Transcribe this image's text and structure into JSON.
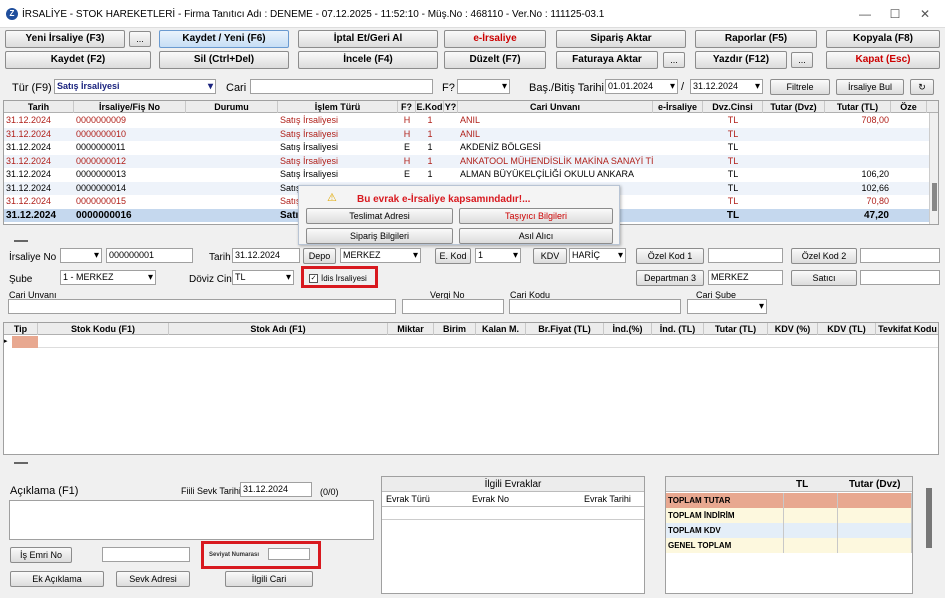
{
  "title": "İRSALİYE - STOK HAREKETLERİ - Firma Tanıtıcı Adı : DENEME - 07.12.2025 - 11:52:10 - Müş.No : 468110 - Ver.No : 111125-03.1",
  "toolbar1": {
    "yeni": "Yeni İrsaliye (F3)",
    "dots": "...",
    "kaydet_yeni": "Kaydet / Yeni (F6)",
    "iptal": "İptal Et/Geri Al",
    "eirsaliye": "e-İrsaliye",
    "siparis_aktar": "Sipariş Aktar",
    "raporlar": "Raporlar (F5)",
    "kopyala": "Kopyala (F8)"
  },
  "toolbar2": {
    "kaydet": "Kaydet (F2)",
    "sil": "Sil (Ctrl+Del)",
    "incele": "İncele (F4)",
    "duzelt": "Düzelt (F7)",
    "faturaya": "Faturaya Aktar",
    "dots1": "...",
    "yazdir": "Yazdır (F12)",
    "dots2": "...",
    "kapat": "Kapat (Esc)"
  },
  "filter": {
    "tur_label": "Tür (F9)",
    "tur_value": "Satış İrsaliyesi",
    "cari_label": "Cari",
    "f_label": "F?",
    "tarih_label": "Baş./Bitiş Tarihi",
    "start": "01.01.2024",
    "sep": "/",
    "end": "31.12.2024",
    "filtrele": "Filtrele",
    "irsaliye_bul": "İrsaliye Bul",
    "refresh": "↻"
  },
  "list_headers": [
    "Tarih",
    "İrsaliye/Fiş No",
    "Durumu",
    "İşlem Türü",
    "F?",
    "E.Kod",
    "Y?",
    "Cari Unvanı",
    "e-İrsaliye",
    "Dvz.Cinsi",
    "Tutar (Dvz)",
    "Tutar (TL)",
    "Öze"
  ],
  "list_rows": [
    {
      "tarih": "31.12.2024",
      "no": "0000000009",
      "islem": "Satış İrsaliyesi",
      "f": "H",
      "ekod": "1",
      "cari": "ANIL",
      "dvz": "TL",
      "tl": "708,00",
      "red": true
    },
    {
      "tarih": "31.12.2024",
      "no": "0000000010",
      "islem": "Satış İrsaliyesi",
      "f": "H",
      "ekod": "1",
      "cari": "ANIL",
      "dvz": "TL",
      "tl": "",
      "red": true
    },
    {
      "tarih": "31.12.2024",
      "no": "0000000011",
      "islem": "Satış İrsaliyesi",
      "f": "E",
      "ekod": "1",
      "cari": "AKDENİZ BÖLGESİ",
      "dvz": "TL",
      "tl": "",
      "red": false
    },
    {
      "tarih": "31.12.2024",
      "no": "0000000012",
      "islem": "Satış İrsaliyesi",
      "f": "H",
      "ekod": "1",
      "cari": "ANKATOOL MÜHENDİSLİK MAKİNA SANAYİ TİCAR",
      "dvz": "TL",
      "tl": "",
      "red": true
    },
    {
      "tarih": "31.12.2024",
      "no": "0000000013",
      "islem": "Satış İrsaliyesi",
      "f": "E",
      "ekod": "1",
      "cari": "ALMAN BÜYÜKELÇİLİĞİ OKULU ANKARA",
      "dvz": "TL",
      "tl": "106,20",
      "red": false
    },
    {
      "tarih": "31.12.2024",
      "no": "0000000014",
      "islem": "Satış",
      "f": "",
      "ekod": "",
      "cari": "",
      "dvz": "TL",
      "tl": "102,66",
      "red": false
    },
    {
      "tarih": "31.12.2024",
      "no": "0000000015",
      "islem": "Satış",
      "f": "",
      "ekod": "",
      "cari": "",
      "dvz": "TL",
      "tl": "70,80",
      "red": true
    },
    {
      "tarih": "31.12.2024",
      "no": "0000000016",
      "islem": "Satış",
      "f": "",
      "ekod": "",
      "cari": "",
      "dvz": "TL",
      "tl": "47,20",
      "red": false,
      "bold": true
    }
  ],
  "popup": {
    "warning": "Bu evrak e-İrsaliye kapsamındadır!...",
    "teslimat": "Teslimat Adresi",
    "tasiyici": "Taşıyıcı Bilgileri",
    "siparis": "Sipariş Bilgileri",
    "asil": "Asıl Alıcı"
  },
  "form": {
    "irsaliye_no_label": "İrsaliye No",
    "irsaliye_no": "000000001",
    "tarih_label": "Tarih",
    "tarih": "31.12.2024",
    "depo": "Depo",
    "depo_value": "MERKEZ",
    "ekod": "E. Kod",
    "ekod_value": "1",
    "kdv": "KDV",
    "kdv_value": "HARİÇ",
    "ozel_kod1": "Özel Kod 1",
    "ozel_kod2": "Özel Kod 2",
    "sube_label": "Şube",
    "sube_value": "1 - MERKEZ",
    "doviz_label": "Döviz Cinsi",
    "doviz_value": "TL",
    "idis": "İdis İrsaliyesi",
    "departman": "Departman 3",
    "departman_value": "MERKEZ",
    "satici": "Satıcı",
    "cari_unvani": "Cari Unvanı",
    "vergi_no": "Vergi No",
    "cari_kodu": "Cari Kodu",
    "cari_sube": "Cari Şube"
  },
  "detail_headers": [
    "Tip",
    "Stok Kodu (F1)",
    "Stok Adı (F1)",
    "Miktar",
    "Birim",
    "Kalan M.",
    "Br.Fiyat (TL)",
    "İnd.(%)",
    "İnd. (TL)",
    "Tutar (TL)",
    "KDV (%)",
    "KDV (TL)",
    "Tevkifat Kodu"
  ],
  "bottom": {
    "aciklama": "Açıklama (F1)",
    "fiili_label": "Fiili Sevk Tarihi",
    "fiili_value": "31.12.2024",
    "count": "(0/0)",
    "is_emri": "İş Emri No",
    "seviyat": "Seviyat Numarası",
    "ek_aciklama": "Ek Açıklama",
    "sevk_adresi": "Sevk Adresi",
    "ilgili_cari": "İlgili Cari"
  },
  "ilgili": {
    "title": "İlgili Evraklar",
    "headers": [
      "Evrak Türü",
      "Evrak No",
      "Evrak Tarihi"
    ]
  },
  "totals": {
    "headers": [
      "TL",
      "Tutar (Dvz)"
    ],
    "rows": [
      "TOPLAM TUTAR",
      "TOPLAM İNDİRİM",
      "TOPLAM KDV",
      "GENEL TOPLAM"
    ]
  },
  "colors": {
    "selected_row": "#c5d8ee",
    "highlight": "#d8191f",
    "total_head": "#e8a890"
  }
}
